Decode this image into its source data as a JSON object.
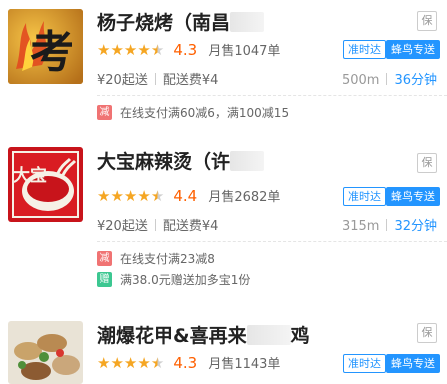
{
  "shops": [
    {
      "name_visible": "杨子烧烤（南昌",
      "thumb_text": "考",
      "tag": "保",
      "score": "4.3",
      "sales": "月售1047单",
      "stars": [
        1,
        1,
        1,
        1,
        0.5
      ],
      "badge_ontime": "准时达",
      "badge_delivery": "蜂鸟专送",
      "min_order": "¥20起送",
      "delivery_fee": "配送费¥4",
      "distance": "500m",
      "time": "36分钟",
      "promos": [
        {
          "icon": "减",
          "color": "#f07373",
          "text": "在线支付满60减6，满100减15"
        }
      ]
    },
    {
      "name_visible": "大宝麻辣烫（许",
      "thumb_text": "大宝",
      "tag": "保",
      "score": "4.4",
      "sales": "月售2682单",
      "stars": [
        1,
        1,
        1,
        1,
        0.5
      ],
      "badge_ontime": "准时达",
      "badge_delivery": "蜂鸟专送",
      "min_order": "¥20起送",
      "delivery_fee": "配送费¥4",
      "distance": "315m",
      "time": "32分钟",
      "promos": [
        {
          "icon": "减",
          "color": "#f07373",
          "text": "在线支付满23减8"
        },
        {
          "icon": "赠",
          "color": "#3cc791",
          "text": "满38.0元赠送加多宝1份"
        }
      ]
    },
    {
      "name_visible": "潮爆花甲&喜再来",
      "name_after": "鸡",
      "tag": "保",
      "score": "4.3",
      "sales": "月售1143单",
      "stars": [
        1,
        1,
        1,
        1,
        0.5
      ],
      "badge_ontime": "准时达",
      "badge_delivery": "蜂鸟专送"
    }
  ]
}
